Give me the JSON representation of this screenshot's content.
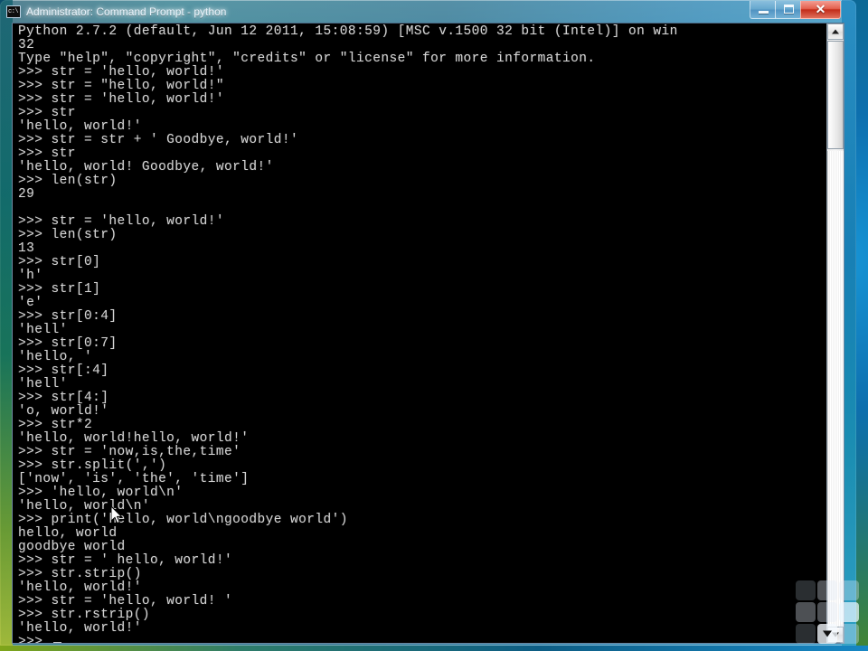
{
  "window": {
    "title": "Administrator: Command Prompt - python",
    "app_icon": "command-prompt-icon",
    "buttons": {
      "minimize_label": "–",
      "maximize_label": "□",
      "close_label": "✕"
    }
  },
  "console": {
    "prompt": ">>> ",
    "cursor": "block-cursor",
    "lines": [
      "Python 2.7.2 (default, Jun 12 2011, 15:08:59) [MSC v.1500 32 bit (Intel)] on win",
      "32",
      "Type \"help\", \"copyright\", \"credits\" or \"license\" for more information.",
      ">>> str = 'hello, world!'",
      ">>> str = \"hello, world!\"",
      ">>> str = 'hello, world!'",
      ">>> str",
      "'hello, world!'",
      ">>> str = str + ' Goodbye, world!'",
      ">>> str",
      "'hello, world! Goodbye, world!'",
      ">>> len(str)",
      "29",
      "",
      ">>> str = 'hello, world!'",
      ">>> len(str)",
      "13",
      ">>> str[0]",
      "'h'",
      ">>> str[1]",
      "'e'",
      ">>> str[0:4]",
      "'hell'",
      ">>> str[0:7]",
      "'hello, '",
      ">>> str[:4]",
      "'hell'",
      ">>> str[4:]",
      "'o, world!'",
      ">>> str*2",
      "'hello, world!hello, world!'",
      ">>> str = 'now,is,the,time'",
      ">>> str.split(',')",
      "['now', 'is', 'the', 'time']",
      ">>> 'hello, world\\n'",
      "'hello, world\\n'",
      ">>> print('hello, world\\ngoodbye world')",
      "hello, world",
      "goodbye world",
      ">>> str = ' hello, world!'",
      ">>> str.strip()",
      "'hello, world!'",
      ">>> str = 'hello, world! '",
      ">>> str.rstrip()",
      "'hello, world!'",
      ">>> "
    ]
  },
  "scrollbar": {
    "up_arrow": "scroll-up-arrow",
    "down_arrow": "scroll-down-arrow",
    "thumb": "scroll-thumb"
  },
  "overlay": {
    "grid_widget": "resize-grid-widget",
    "mouse_pointer": "mouse-pointer-arrow"
  },
  "colors": {
    "console_background": "#000000",
    "console_foreground": "#d4d4d4",
    "frame_glass": "#0f6a8a",
    "close_button": "#c22c19"
  }
}
